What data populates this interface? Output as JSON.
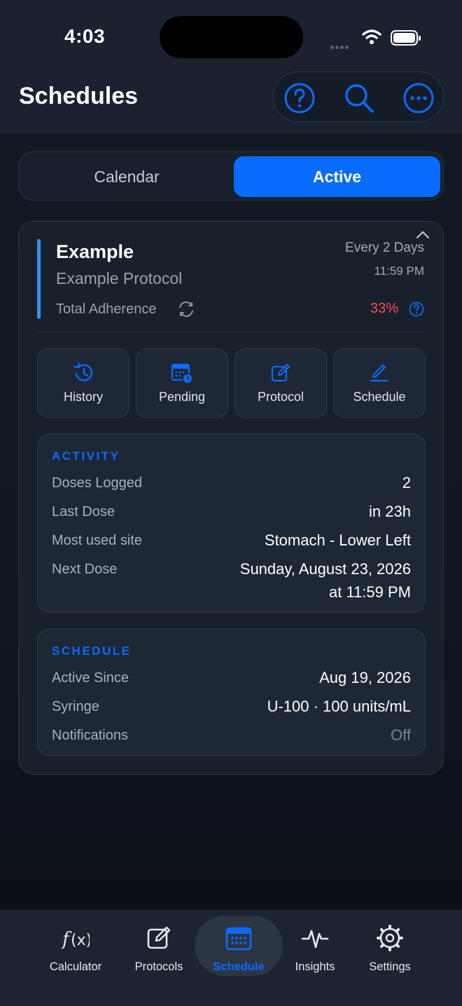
{
  "status_bar": {
    "time": "4:03"
  },
  "header": {
    "title": "Schedules"
  },
  "segments": {
    "calendar": "Calendar",
    "active": "Active"
  },
  "protocol": {
    "name": "Example",
    "subtitle": "Example Protocol",
    "frequency": "Every 2 Days",
    "time": "11:59 PM",
    "adherence_label": "Total Adherence",
    "adherence_value": "33%"
  },
  "actions": [
    "History",
    "Pending",
    "Protocol",
    "Schedule"
  ],
  "activity": {
    "heading": "ACTIVITY",
    "doses_logged_label": "Doses Logged",
    "doses_logged_value": "2",
    "last_dose_label": "Last Dose",
    "last_dose_value": "in 23h",
    "most_used_site_label": "Most used site",
    "most_used_site_value": "Stomach - Lower Left",
    "next_dose_label": "Next Dose",
    "next_dose_date": "Sunday, August 23, 2026",
    "next_dose_time": "at 11:59 PM"
  },
  "schedule": {
    "heading": "SCHEDULE",
    "active_since_label": "Active Since",
    "active_since_value": "Aug 19, 2026",
    "syringe_label": "Syringe",
    "syringe_value": "U-100 · 100 units/mL",
    "notifications_label": "Notifications",
    "notifications_value": "Off"
  },
  "tabs": [
    "Calculator",
    "Protocols",
    "Schedule",
    "Insights",
    "Settings"
  ],
  "colors": {
    "accent": "#0a6cff",
    "danger": "#ff4d4d",
    "bar": "#3d8ff0"
  }
}
